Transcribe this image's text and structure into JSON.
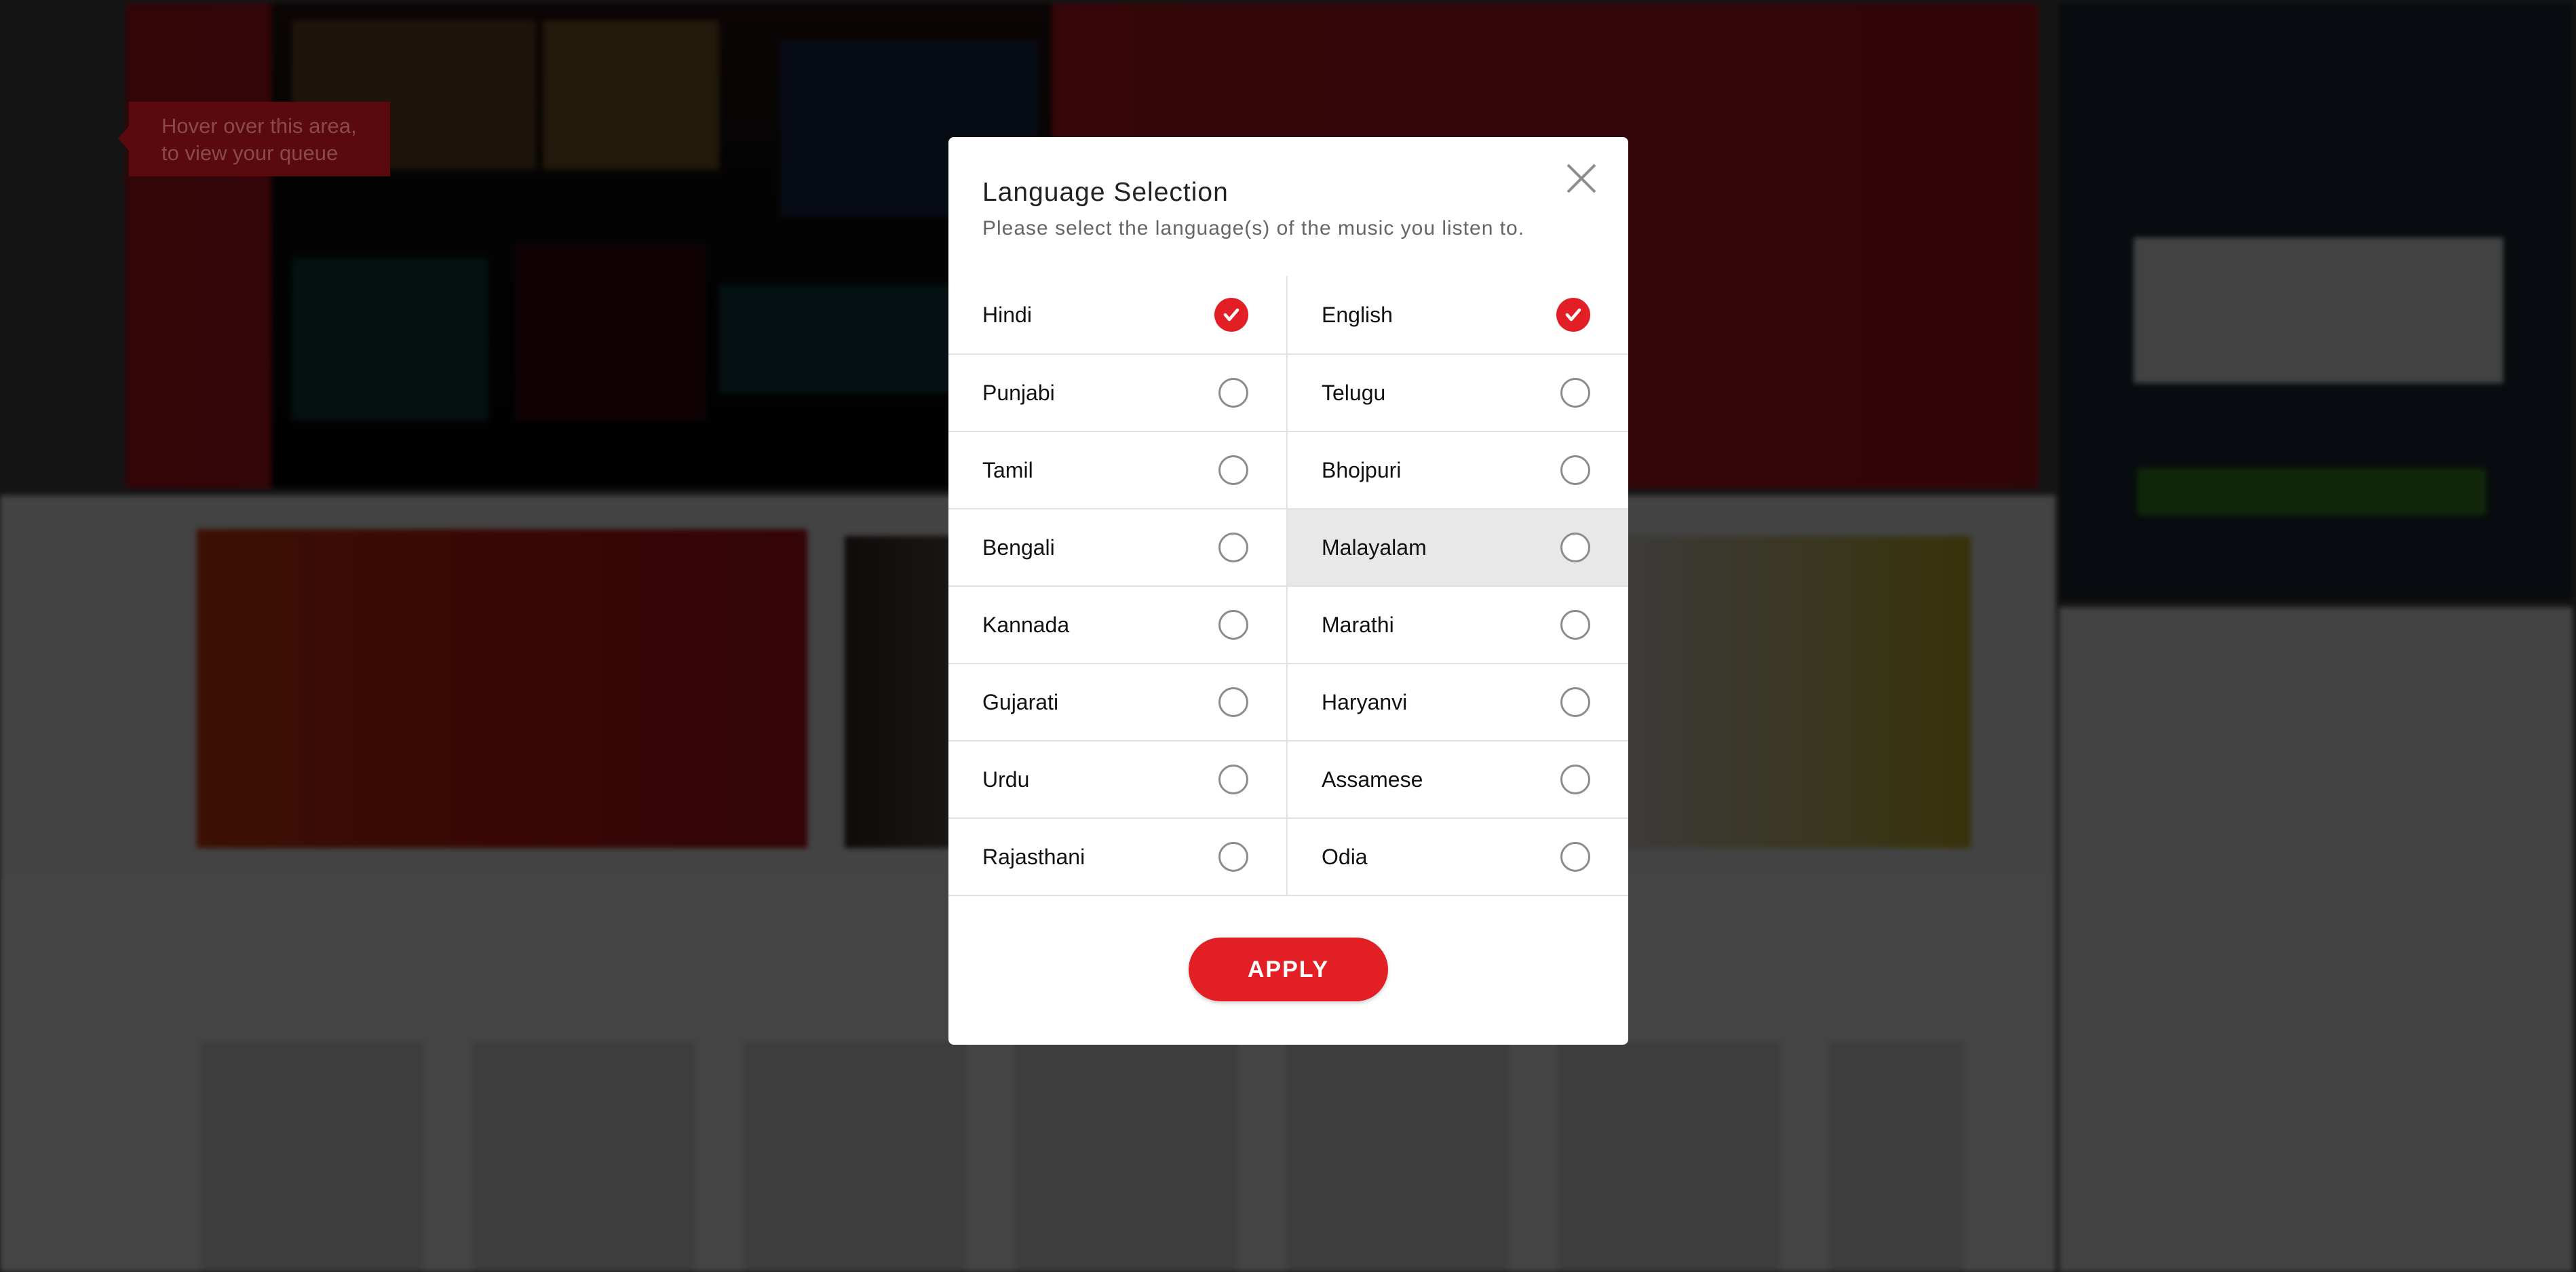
{
  "queue_hint": "Hover over this area,\nto view your queue",
  "modal": {
    "title": "Language Selection",
    "subtitle": "Please select the language(s) of the music you listen to.",
    "apply_label": "APPLY",
    "close_icon": "close-icon",
    "languages": [
      {
        "label": "Hindi",
        "checked": true
      },
      {
        "label": "English",
        "checked": true
      },
      {
        "label": "Punjabi",
        "checked": false
      },
      {
        "label": "Telugu",
        "checked": false
      },
      {
        "label": "Tamil",
        "checked": false
      },
      {
        "label": "Bhojpuri",
        "checked": false
      },
      {
        "label": "Bengali",
        "checked": false
      },
      {
        "label": "Malayalam",
        "checked": false,
        "hovered": true
      },
      {
        "label": "Kannada",
        "checked": false
      },
      {
        "label": "Marathi",
        "checked": false
      },
      {
        "label": "Gujarati",
        "checked": false
      },
      {
        "label": "Haryanvi",
        "checked": false
      },
      {
        "label": "Urdu",
        "checked": false
      },
      {
        "label": "Assamese",
        "checked": false
      },
      {
        "label": "Rajasthani",
        "checked": false
      },
      {
        "label": "Odia",
        "checked": false
      }
    ]
  },
  "colors": {
    "accent": "#e31f26",
    "overlay": "rgba(0,0,0,0.72)",
    "hover_row": "#e8e8e8"
  }
}
